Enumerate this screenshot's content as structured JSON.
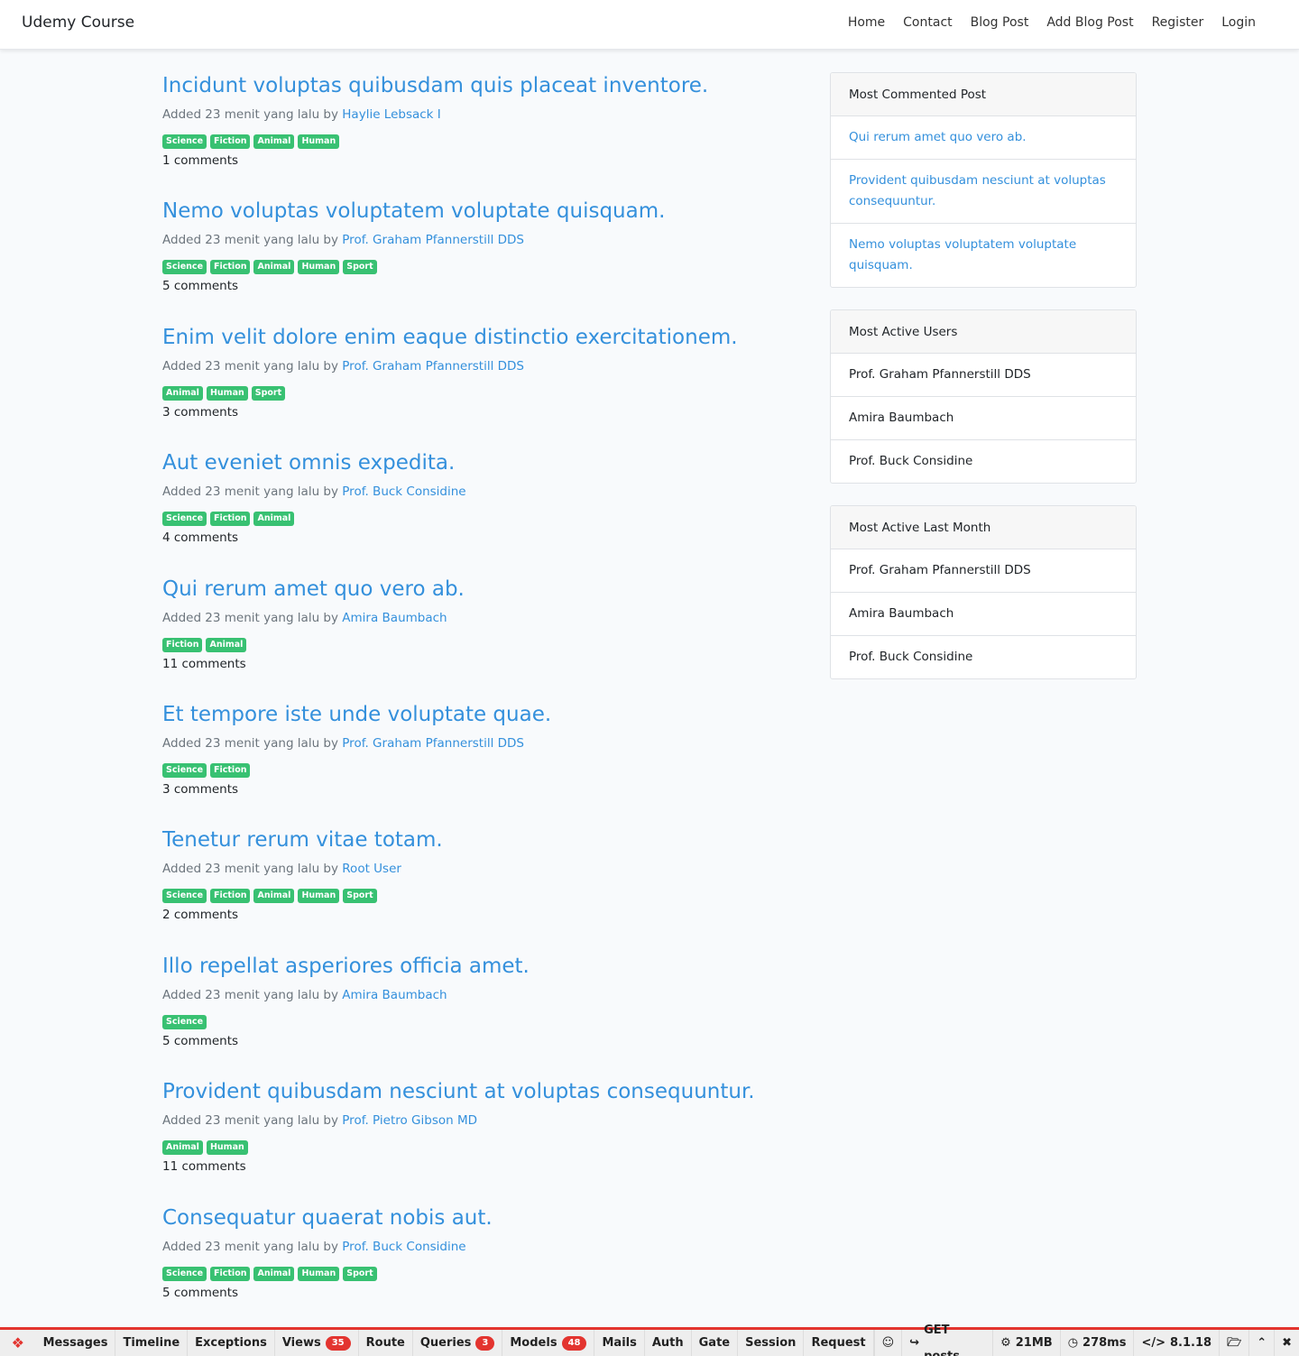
{
  "navbar": {
    "brand": "Udemy Course",
    "links": [
      "Home",
      "Contact",
      "Blog Post",
      "Add Blog Post",
      "Register",
      "Login"
    ]
  },
  "posts": [
    {
      "title": "Incidunt voluptas quibusdam quis placeat inventore.",
      "meta_prefix": "Added 23 menit yang lalu by",
      "author": "Haylie Lebsack I",
      "tags": [
        "Science",
        "Fiction",
        "Animal",
        "Human"
      ],
      "comments": "1 comments"
    },
    {
      "title": "Nemo voluptas voluptatem voluptate quisquam.",
      "meta_prefix": "Added 23 menit yang lalu by",
      "author": "Prof. Graham Pfannerstill DDS",
      "tags": [
        "Science",
        "Fiction",
        "Animal",
        "Human",
        "Sport"
      ],
      "comments": "5 comments"
    },
    {
      "title": "Enim velit dolore enim eaque distinctio exercitationem.",
      "meta_prefix": "Added 23 menit yang lalu by",
      "author": "Prof. Graham Pfannerstill DDS",
      "tags": [
        "Animal",
        "Human",
        "Sport"
      ],
      "comments": "3 comments"
    },
    {
      "title": "Aut eveniet omnis expedita.",
      "meta_prefix": "Added 23 menit yang lalu by",
      "author": "Prof. Buck Considine",
      "tags": [
        "Science",
        "Fiction",
        "Animal"
      ],
      "comments": "4 comments"
    },
    {
      "title": "Qui rerum amet quo vero ab.",
      "meta_prefix": "Added 23 menit yang lalu by",
      "author": "Amira Baumbach",
      "tags": [
        "Fiction",
        "Animal"
      ],
      "comments": "11 comments"
    },
    {
      "title": "Et tempore iste unde voluptate quae.",
      "meta_prefix": "Added 23 menit yang lalu by",
      "author": "Prof. Graham Pfannerstill DDS",
      "tags": [
        "Science",
        "Fiction"
      ],
      "comments": "3 comments"
    },
    {
      "title": "Tenetur rerum vitae totam.",
      "meta_prefix": "Added 23 menit yang lalu by",
      "author": "Root User",
      "tags": [
        "Science",
        "Fiction",
        "Animal",
        "Human",
        "Sport"
      ],
      "comments": "2 comments"
    },
    {
      "title": "Illo repellat asperiores officia amet.",
      "meta_prefix": "Added 23 menit yang lalu by",
      "author": "Amira Baumbach",
      "tags": [
        "Science"
      ],
      "comments": "5 comments"
    },
    {
      "title": "Provident quibusdam nesciunt at voluptas consequuntur.",
      "meta_prefix": "Added 23 menit yang lalu by",
      "author": "Prof. Pietro Gibson MD",
      "tags": [
        "Animal",
        "Human"
      ],
      "comments": "11 comments"
    },
    {
      "title": "Consequatur quaerat nobis aut.",
      "meta_prefix": "Added 23 menit yang lalu by",
      "author": "Prof. Buck Considine",
      "tags": [
        "Science",
        "Fiction",
        "Animal",
        "Human",
        "Sport"
      ],
      "comments": "5 comments"
    }
  ],
  "sidebar": {
    "most_commented": {
      "title": "Most Commented Post",
      "items": [
        "Qui rerum amet quo vero ab.",
        "Provident quibusdam nesciunt at voluptas consequuntur.",
        "Nemo voluptas voluptatem voluptate quisquam."
      ]
    },
    "most_active_users": {
      "title": "Most Active Users",
      "items": [
        "Prof. Graham Pfannerstill DDS",
        "Amira Baumbach",
        "Prof. Buck Considine"
      ]
    },
    "most_active_last_month": {
      "title": "Most Active Last Month",
      "items": [
        "Prof. Graham Pfannerstill DDS",
        "Amira Baumbach",
        "Prof. Buck Considine"
      ]
    }
  },
  "debugbar": {
    "tabs": [
      {
        "label": "Messages"
      },
      {
        "label": "Timeline"
      },
      {
        "label": "Exceptions"
      },
      {
        "label": "Views",
        "badge": "35"
      },
      {
        "label": "Route"
      },
      {
        "label": "Queries",
        "badge": "3"
      },
      {
        "label": "Models",
        "badge": "48"
      },
      {
        "label": "Mails"
      },
      {
        "label": "Auth"
      },
      {
        "label": "Gate"
      },
      {
        "label": "Session"
      },
      {
        "label": "Request"
      }
    ],
    "request": "GET posts",
    "memory": "21MB",
    "time": "278ms",
    "php_version": "8.1.18"
  },
  "colors": {
    "link": "#3490dc",
    "tag": "#38c172",
    "debug_accent": "#e3342f"
  }
}
